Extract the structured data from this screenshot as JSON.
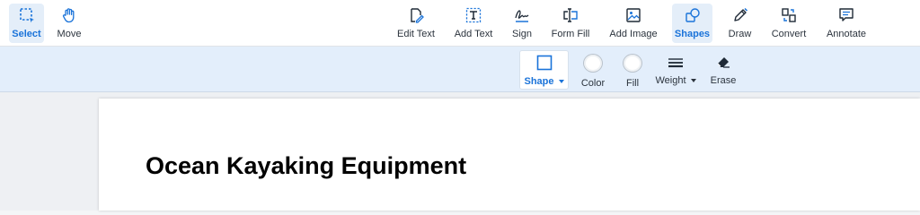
{
  "toolbar": {
    "left_tools": [
      {
        "label": "Select",
        "icon": "select-icon",
        "active": true
      },
      {
        "label": "Move",
        "icon": "hand-icon",
        "active": false
      }
    ],
    "tools": [
      {
        "label": "Edit Text",
        "icon": "edit-text-icon"
      },
      {
        "label": "Add Text",
        "icon": "add-text-icon"
      },
      {
        "label": "Sign",
        "icon": "signature-icon"
      },
      {
        "label": "Form Fill",
        "icon": "form-fill-icon"
      },
      {
        "label": "Add Image",
        "icon": "image-icon"
      },
      {
        "label": "Shapes",
        "icon": "shapes-icon",
        "active": true
      },
      {
        "label": "Draw",
        "icon": "pencil-icon"
      },
      {
        "label": "Convert",
        "icon": "convert-icon"
      },
      {
        "label": "Annotate",
        "icon": "comment-icon"
      }
    ]
  },
  "shape_options": {
    "shape": "Shape",
    "color": "Color",
    "fill": "Fill",
    "weight": "Weight",
    "erase": "Erase"
  },
  "document": {
    "title": "Ocean Kayaking Equipment"
  },
  "colors": {
    "accent": "#1a73d9",
    "active_bg": "#e4eef9",
    "subbar_bg": "#e3eefb"
  }
}
